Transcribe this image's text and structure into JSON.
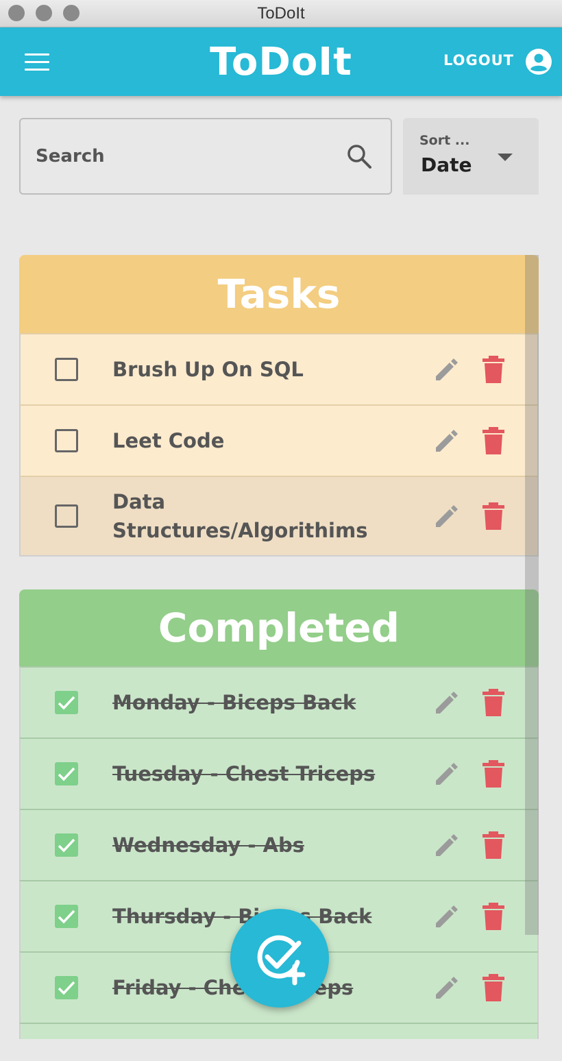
{
  "window": {
    "title": "ToDoIt"
  },
  "appbar": {
    "title": "ToDoIt",
    "logout_label": "LOGOUT"
  },
  "search": {
    "placeholder": "Search",
    "value": ""
  },
  "sort": {
    "label": "Sort ...",
    "value": "Date"
  },
  "tasks": {
    "title": "Tasks",
    "items": [
      {
        "text": "Brush Up On SQL",
        "done": false
      },
      {
        "text": "Leet Code",
        "done": false
      },
      {
        "text": "Data Structures/Algorithims",
        "done": false
      }
    ]
  },
  "completed": {
    "title": "Completed",
    "items": [
      {
        "text": "Monday - Biceps Back",
        "done": true
      },
      {
        "text": "Tuesday - Chest Triceps",
        "done": true
      },
      {
        "text": "Wednesday - Abs",
        "done": true
      },
      {
        "text": "Thursday - Biceps Back",
        "done": true
      },
      {
        "text": "Friday - Chest Triceps",
        "done": true
      }
    ]
  },
  "colors": {
    "primary": "#27b9d5",
    "tasks_header": "#f3cd81",
    "completed_header": "#93ce8a",
    "delete": "#e3575f",
    "edit": "#9b9b9b"
  },
  "icons": {
    "menu": "hamburger-menu-icon",
    "account": "account-circle-icon",
    "search": "search-icon",
    "edit": "pencil-icon",
    "delete": "trash-icon",
    "add_task": "check-plus-icon"
  }
}
